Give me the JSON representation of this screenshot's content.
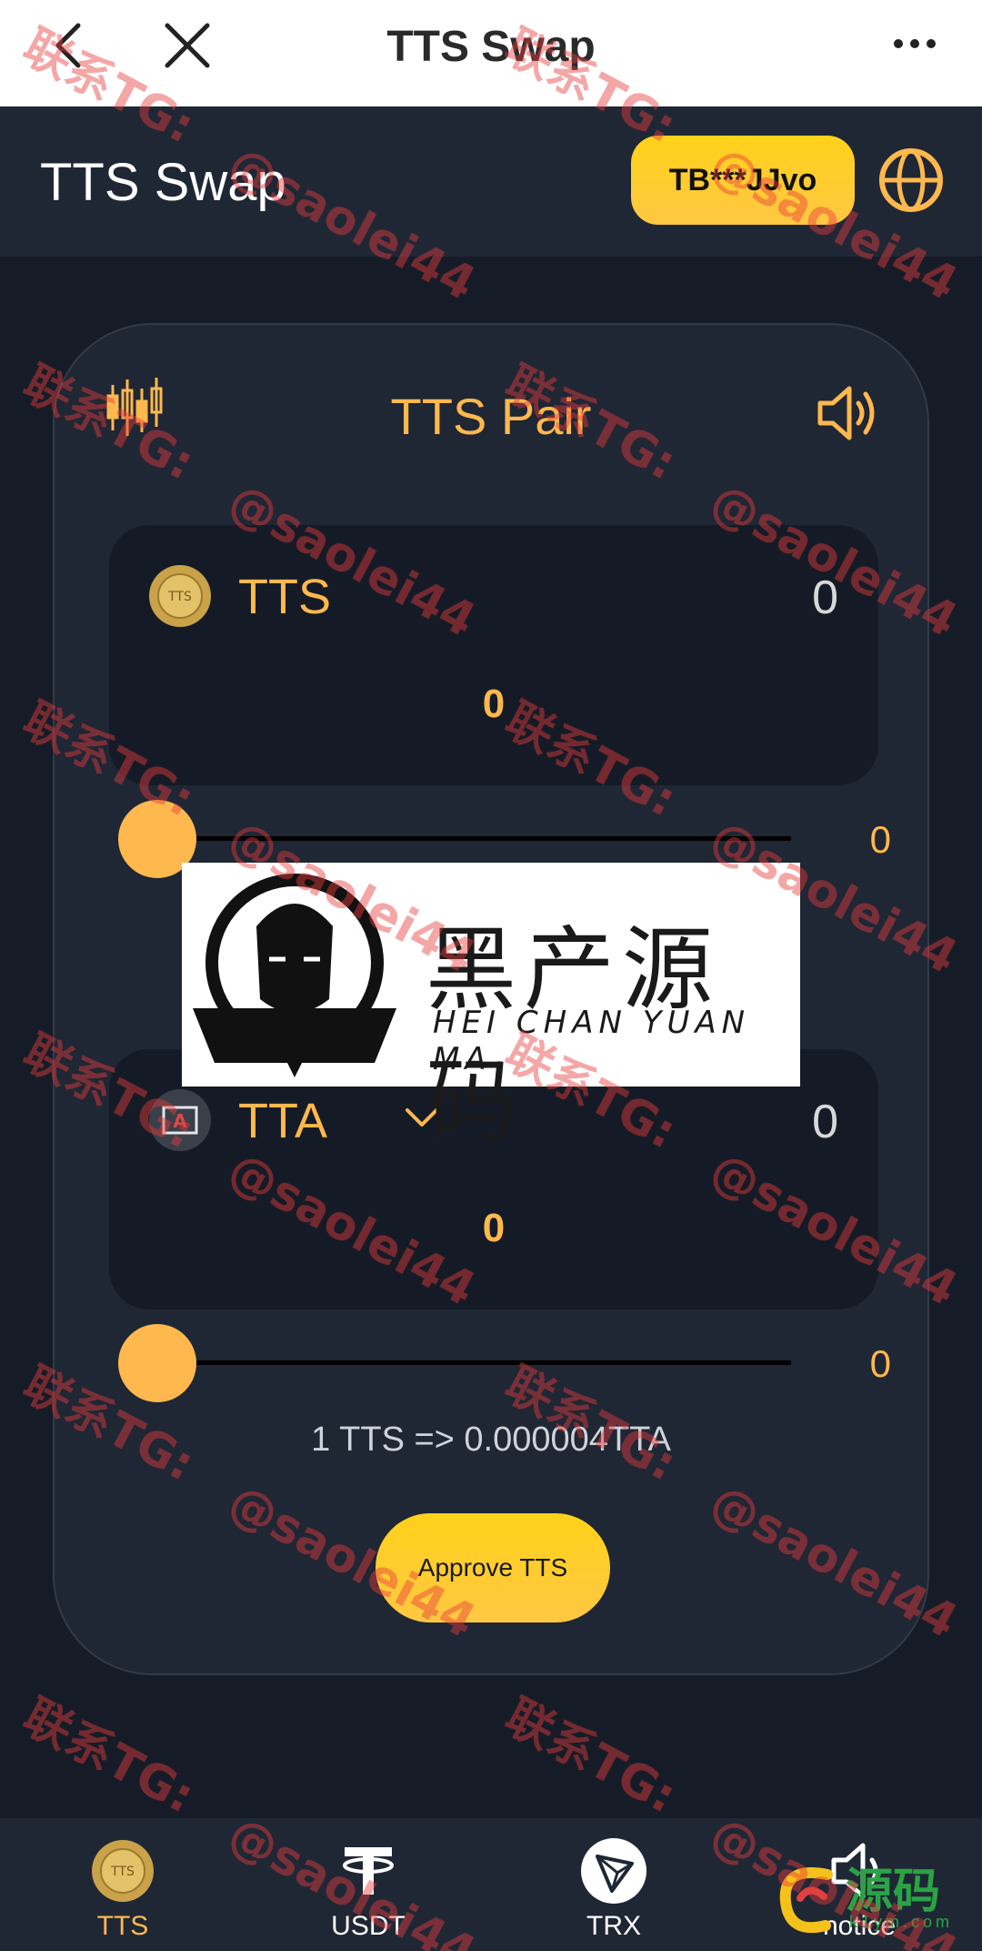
{
  "nav": {
    "title": "TTS Swap"
  },
  "header": {
    "title": "TTS Swap",
    "wallet": "TB***JJvo"
  },
  "card": {
    "title": "TTS Pair",
    "from": {
      "name": "TTS",
      "balance": "0",
      "amount": "0",
      "slider_value": "0",
      "slider_fraction": 0
    },
    "to": {
      "name": "TTA",
      "balance": "0",
      "amount": "0",
      "slider_value": "0",
      "slider_fraction": 0
    },
    "rate": "1 TTS => 0.000004TTA",
    "approve_label": "Approve TTS"
  },
  "banner": {
    "cn": "黑产源码",
    "pinyin": "HEI CHAN YUAN MA"
  },
  "tabs": [
    {
      "label": "TTS",
      "icon": "tts-coin-icon",
      "active": true
    },
    {
      "label": "USDT",
      "icon": "usdt-icon",
      "active": false
    },
    {
      "label": "TRX",
      "icon": "trx-icon",
      "active": false
    },
    {
      "label": "notice",
      "icon": "speaker-icon",
      "active": false
    }
  ],
  "watermark": {
    "cn": "联系TG:",
    "handle": "@saolei44"
  },
  "corner_logo": {
    "text": "源码",
    "sub": "k1ym.com"
  },
  "colors": {
    "accent": "#ffb84e",
    "button": "#ffd21a",
    "background": "#161c27",
    "panel": "#1f2634"
  }
}
